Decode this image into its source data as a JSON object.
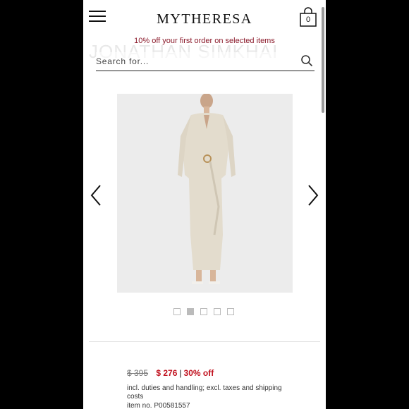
{
  "header": {
    "logo": "MYTHERESA",
    "bag_count": "0",
    "promo": "10% off your first order on selected items"
  },
  "brand_ghost": "JONATHAN SIMKHAI",
  "search": {
    "placeholder": "Search for..."
  },
  "gallery": {
    "image_count": 5,
    "active_index": 1
  },
  "product": {
    "old_price": "$ 395",
    "new_price": "$ 276",
    "separator": "|",
    "discount": "30% off",
    "duties": "incl. duties and handling; excl. taxes and shipping costs",
    "item_no": "item no. P00581557"
  },
  "colors": {
    "promo": "#8b1a2b",
    "sale": "#c1121f",
    "dress": "#e3dccd"
  }
}
